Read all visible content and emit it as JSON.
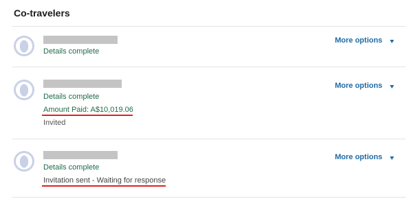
{
  "section": {
    "title": "Co-travelers"
  },
  "travelers": [
    {
      "status": "Details complete",
      "more_options": "More options"
    },
    {
      "status": "Details complete",
      "amount_paid": "Amount Paid: A$10,019.06",
      "invite_status": "Invited",
      "more_options": "More options"
    },
    {
      "status": "Details complete",
      "invitation": "Invitation sent - Waiting for response",
      "more_options": "More options"
    }
  ],
  "icons": {
    "avatar": "user-avatar-icon",
    "dropdown": "caret-down-icon"
  },
  "colors": {
    "status_green": "#1e6b4a",
    "link_blue": "#1f6aa5",
    "highlight_red": "#e02020",
    "placeholder_gray": "#c4c4c4",
    "avatar_fill": "#c9d1e6"
  }
}
